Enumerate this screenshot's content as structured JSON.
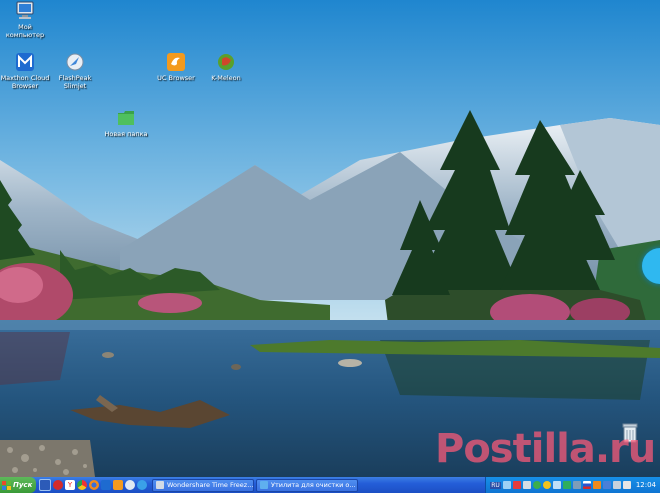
{
  "desktop_icons": [
    {
      "id": "my-computer",
      "label": "Мой\nкомпьютер",
      "icon": "computer-icon"
    },
    {
      "id": "maxthon",
      "label": "Maxthon Cloud\nBrowser",
      "icon": "maxthon-icon"
    },
    {
      "id": "flashpeak",
      "label": "FlashPeak\nSlimjet",
      "icon": "slimjet-icon"
    },
    {
      "id": "ucbrowser",
      "label": "UC Browser",
      "icon": "uc-browser-icon"
    },
    {
      "id": "kmeleon",
      "label": "K-Meleon",
      "icon": "k-meleon-icon"
    },
    {
      "id": "new-folder",
      "label": "Новая папка",
      "icon": "folder-icon"
    }
  ],
  "watermark": "Postilla.ru",
  "taskbar": {
    "start_label": "Пуск",
    "quick_launch": [
      "show-desktop-icon",
      "opera-icon",
      "yandex-icon",
      "chrome-icon",
      "firefox-icon",
      "maxthon-icon",
      "uc-browser-icon",
      "slimjet-icon",
      "ie-icon"
    ],
    "tasks": [
      {
        "label": "Wondershare Time Freez...",
        "icon": "time-freeze-icon"
      },
      {
        "label": "Утилита для очистки о...",
        "icon": "cleaner-icon"
      }
    ],
    "tray_lang": "RU",
    "clock": "12:04"
  },
  "colors": {
    "taskbar": "#245ed8",
    "start": "#3a9a38",
    "tray": "#0f74d2",
    "watermark": "#ff5a78"
  }
}
